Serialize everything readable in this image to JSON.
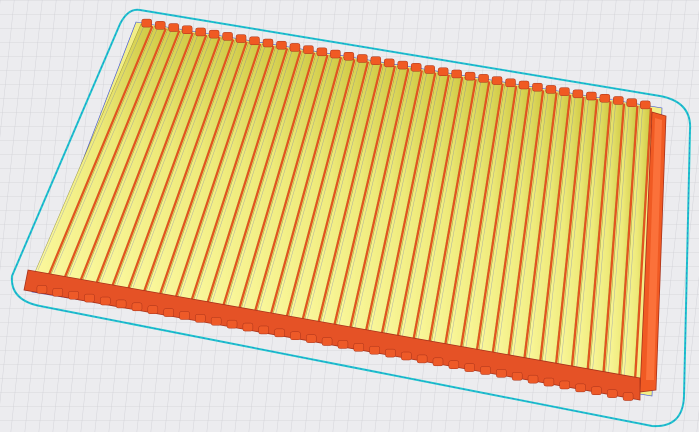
{
  "viewport": {
    "view_mode": "layer-view",
    "background_color": "#e9e9ec",
    "grid_line_color": "#c9c9cf",
    "grid_major_color": "#b9b9c0"
  },
  "model": {
    "shape": "corrugated-plate",
    "top_rib_color": "#f3f08a",
    "top_rib_shadow": "#c9c33c",
    "wall_color": "#f05a23",
    "wall_dark": "#c8401a",
    "skirt_color": "#2bc9cc",
    "travel_color": "#3a4fd6"
  }
}
